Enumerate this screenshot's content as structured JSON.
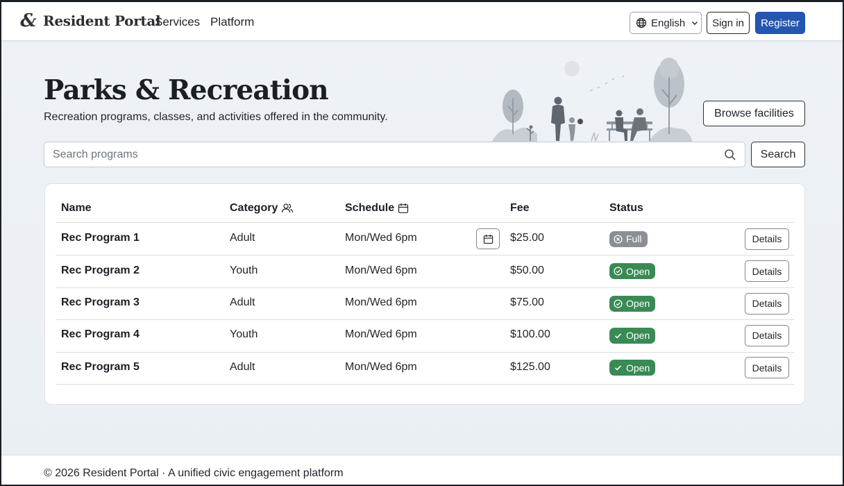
{
  "header": {
    "logo_glyph": "&",
    "brand": "Resident Portal",
    "nav": [
      {
        "label": "Services"
      },
      {
        "label": "Platform"
      }
    ],
    "language": "English",
    "sign_in": "Sign in",
    "register": "Register",
    "accent_color": "#2456b1"
  },
  "hero": {
    "title": "Parks & Recreation",
    "subtitle": "Recreation programs, classes, and activities offered in the community.",
    "browse_button": "Browse facilities",
    "illustration_icon": "park-family-illustration"
  },
  "search": {
    "placeholder": "Search programs",
    "value": "",
    "button": "Search",
    "icon": "search-icon"
  },
  "table": {
    "columns": [
      {
        "label": "Name",
        "icon": ""
      },
      {
        "label": "Category",
        "icon": "users-icon"
      },
      {
        "label": "Schedule",
        "icon": "calendar-icon"
      },
      {
        "label": "Fee",
        "icon": ""
      },
      {
        "label": "Status",
        "icon": ""
      }
    ],
    "rows": [
      {
        "name": "Rec Program 1",
        "category": "Adult",
        "schedule": "Mon/Wed 6pm",
        "fee": "$25.00",
        "status": "Full",
        "status_icon": "x-circle-icon",
        "status_color": "#8a8f95",
        "has_calendar_button": true,
        "action": "Details"
      },
      {
        "name": "Rec Program 2",
        "category": "Youth",
        "schedule": "Mon/Wed 6pm",
        "fee": "$50.00",
        "status": "Open",
        "status_icon": "check-circle-icon",
        "status_color": "#3a8a55",
        "has_calendar_button": false,
        "action": "Details"
      },
      {
        "name": "Rec Program 3",
        "category": "Adult",
        "schedule": "Mon/Wed 6pm",
        "fee": "$75.00",
        "status": "Open",
        "status_icon": "check-circle-icon",
        "status_color": "#3a8a55",
        "has_calendar_button": false,
        "action": "Details"
      },
      {
        "name": "Rec Program 4",
        "category": "Youth",
        "schedule": "Mon/Wed 6pm",
        "fee": "$100.00",
        "status": "Open",
        "status_icon": "check-icon",
        "status_color": "#3a8a55",
        "has_calendar_button": false,
        "action": "Details"
      },
      {
        "name": "Rec Program 5",
        "category": "Adult",
        "schedule": "Mon/Wed 6pm",
        "fee": "$125.00",
        "status": "Open",
        "status_icon": "check-icon",
        "status_color": "#3a8a55",
        "has_calendar_button": false,
        "action": "Details"
      }
    ]
  },
  "footer": {
    "text": "© 2026 Resident Portal · A unified civic engagement platform"
  }
}
